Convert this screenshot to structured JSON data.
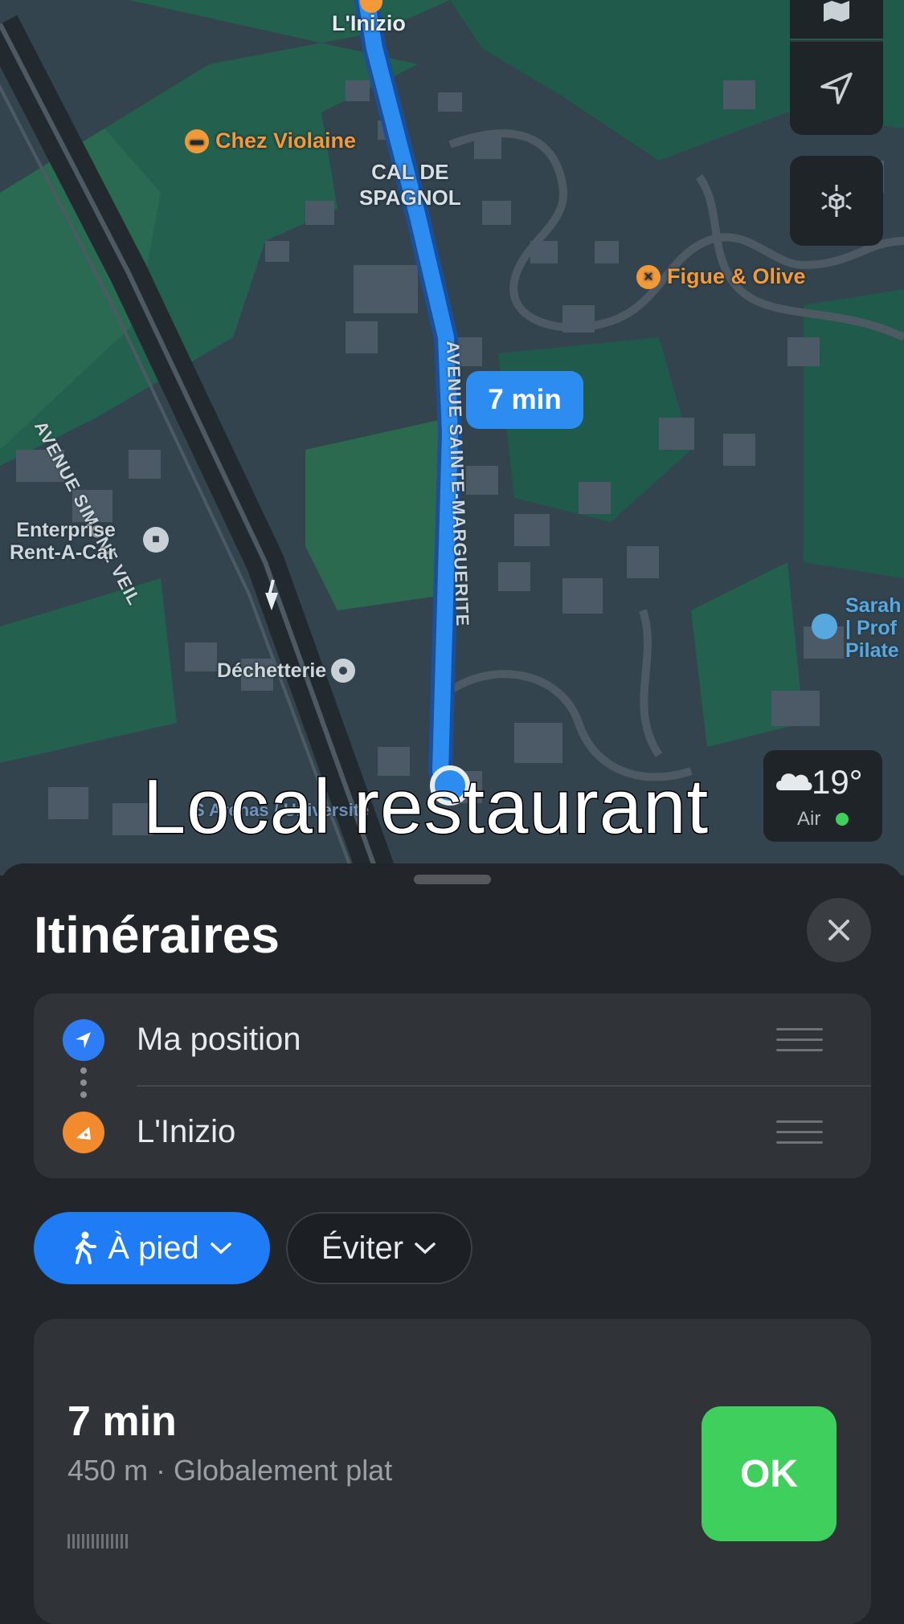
{
  "map": {
    "destination_pin_label": "L'Inizio",
    "pois": {
      "chez_violaine": "Chez Violaine",
      "figue_olive": "Figue & Olive",
      "enterprise_line1": "Enterprise",
      "enterprise_line2": "Rent-A-Car",
      "dechetterie": "Déchetterie",
      "sarah_line1": "Sarah",
      "sarah_line2": "| Prof",
      "sarah_line3": "Pilate"
    },
    "area_label_line1": "CAL DE",
    "area_label_line2": "SPAGNOL",
    "streets": {
      "simone_veil": "AVENUE SIMONE VEIL",
      "sainte_marguerite": "AVENUE SAINTE-MARGUERITE"
    },
    "stop_label": "S Arenas / Université",
    "route_time_bubble": "7 min",
    "weather": {
      "temperature": "19°",
      "air_label": "Air",
      "air_status_color": "#3fcf5c"
    },
    "colors": {
      "route": "#2d8cf0",
      "land": "#33444f",
      "green": "#23604e"
    }
  },
  "caption": "Local restaurant",
  "sheet": {
    "title": "Itinéraires",
    "from": "Ma position",
    "to": "L'Inizio",
    "mode_label": "À pied",
    "avoid_label": "Éviter",
    "route": {
      "time": "7 min",
      "details": "450 m · Globalement plat",
      "go_label": "OK"
    }
  }
}
